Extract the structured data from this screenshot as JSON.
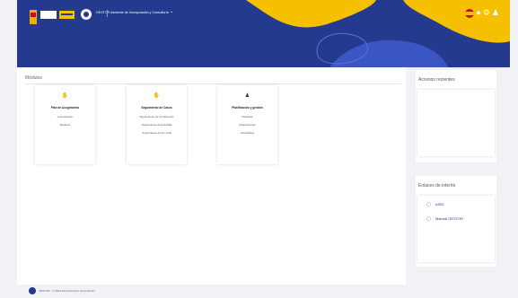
{
  "header": {
    "app_name": "GESTOR",
    "app_title": "Asistente de Incorporación y Consultoría",
    "menu_chevron": "⌄",
    "icons": [
      "spain-flag-icon",
      "bell-icon",
      "gear-icon",
      "user-icon"
    ]
  },
  "main": {
    "section_title": "Módulos",
    "tiles": [
      {
        "icon": "hand-icon",
        "title": "Plan de Acogimiento",
        "links": [
          "Coordinación",
          "Modelos"
        ]
      },
      {
        "icon": "hand-icon",
        "title": "Seguimiento de Casos",
        "links": [
          "Seguimiento de Condiciones",
          "Seguimiento de Actividad",
          "Seguimiento de los CCE"
        ]
      },
      {
        "icon": "person-icon",
        "title": "Planificación y gestión",
        "links": [
          "Planificar",
          "Adquisiciones",
          "Actividades"
        ]
      }
    ]
  },
  "sidebar": {
    "access_title": "Accesos recientes",
    "links_title": "Enlaces de interés",
    "links": [
      "AISD",
      "Manual GESTOR"
    ]
  },
  "footer": {
    "text": "GESTOR · © 2024 Administración de la Nación"
  },
  "colors": {
    "header_bg": "#233a8f",
    "accent_yellow": "#f5c000",
    "page_bg": "#f1f2f6"
  }
}
